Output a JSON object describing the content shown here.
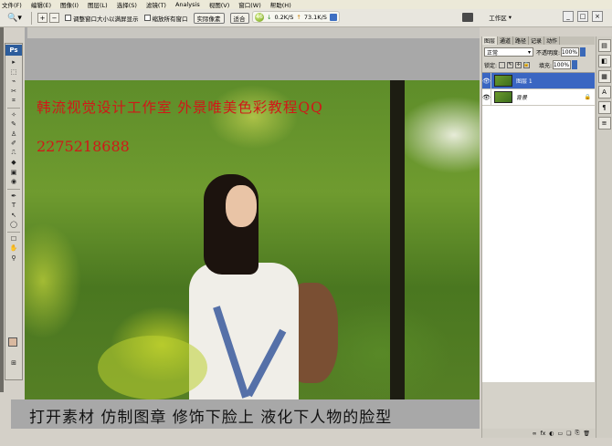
{
  "menu": [
    {
      "label": "文件(F)"
    },
    {
      "label": "编辑(E)"
    },
    {
      "label": "图像(I)"
    },
    {
      "label": "图层(L)"
    },
    {
      "label": "选择(S)"
    },
    {
      "label": "滤镜(T)"
    },
    {
      "label": "Analysis"
    },
    {
      "label": "视图(V)"
    },
    {
      "label": "窗口(W)"
    },
    {
      "label": "帮助(H)"
    }
  ],
  "options": {
    "zoom_icon": "zoom-icon",
    "fit_window_label": "调整窗口大小以满屏显示",
    "zoom_all_label": "缩放所有窗口",
    "actual_pixels_label": "实际像素",
    "fit_screen_label": "适合",
    "net_down": "0.2K/S",
    "net_up": "73.1K/S",
    "net_ball": "46",
    "workspace_label": "工作区",
    "minimize": "_",
    "restore": "□",
    "close": "×"
  },
  "tools": {
    "logo": "Ps",
    "items": [
      "▸",
      "⬚",
      "⌁",
      "✂",
      "⌗",
      "✧",
      "✎",
      "♙",
      "✐",
      "⎍",
      "◆",
      "▣",
      "◉",
      "✒",
      "T",
      "↖",
      "◯",
      "☐",
      "✋",
      "⚲",
      "⊞"
    ]
  },
  "document": {
    "watermark_line1": "韩流视觉设计工作室 外景唯美色彩教程QQ",
    "watermark_line2": "2275218688",
    "caption": "打开素材 仿制图章 修饰下脸上  液化下人物的脸型"
  },
  "layers_panel": {
    "tabs": [
      "图层",
      "通道",
      "路径",
      "记录",
      "动作"
    ],
    "blend_mode": "正常",
    "opacity_label": "不透明度:",
    "opacity_value": "100%",
    "lock_label": "锁定:",
    "fill_label": "填充:",
    "fill_value": "100%",
    "layers": [
      {
        "name": "图层 1",
        "active": true
      },
      {
        "name": "背景",
        "active": false,
        "locked": true
      }
    ],
    "footer_icons": [
      "∞",
      "fx",
      "◐",
      "▭",
      "❏",
      "⎘",
      "🗑"
    ]
  },
  "colors": {
    "accent": "#3a66c2",
    "watermark": "#d01818",
    "foreground_swatch": "#d9b9a0"
  }
}
